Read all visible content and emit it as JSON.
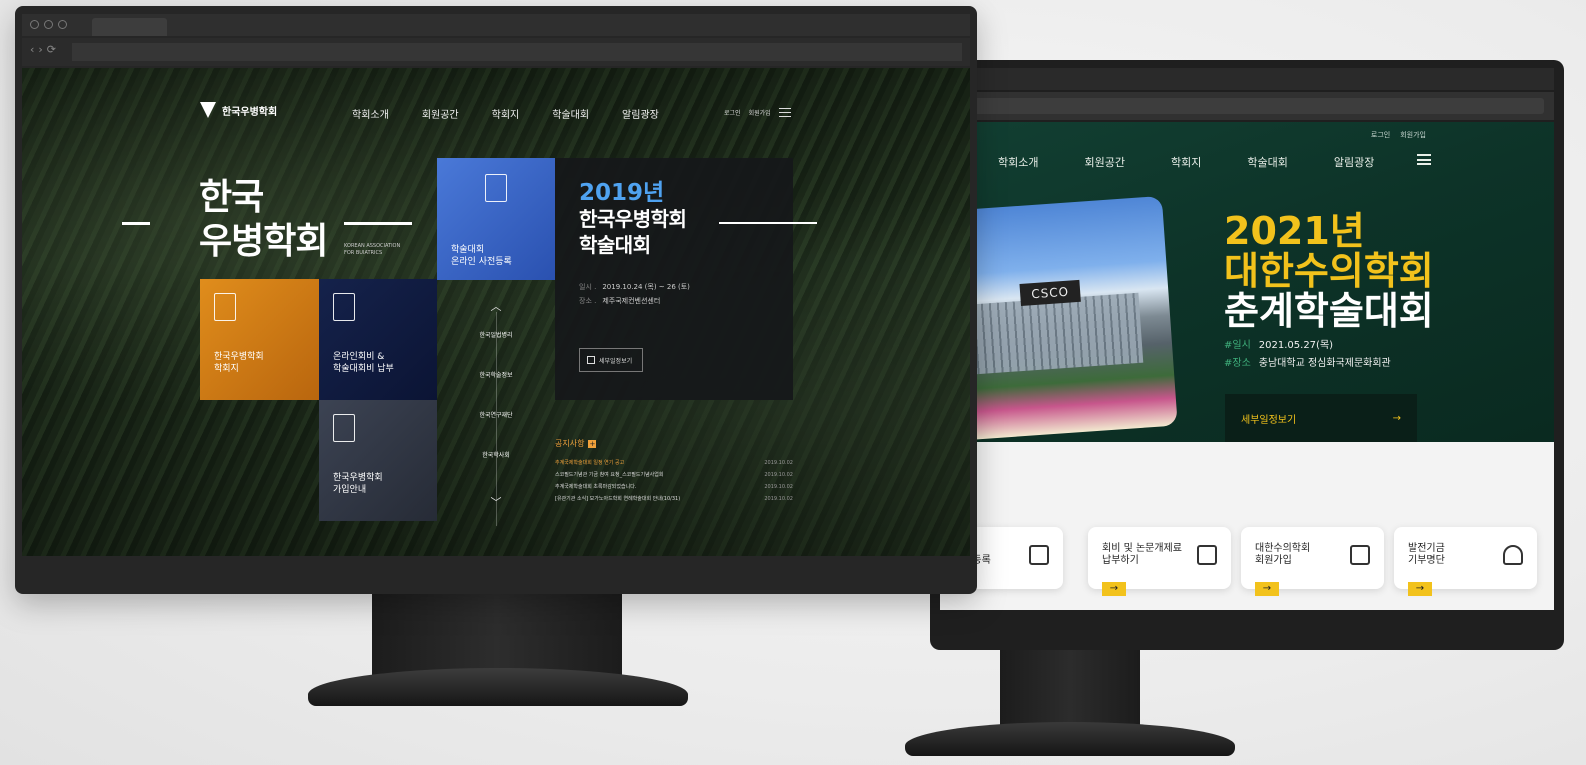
{
  "back_site": {
    "util": [
      "로그인",
      "회원가입"
    ],
    "nav": [
      "학회소개",
      "회원공간",
      "학회지",
      "학술대회",
      "알림광장"
    ],
    "photo_sign": "CSCO",
    "title_year": "2021년",
    "title_line1": "대한수의학회",
    "title_line2": "춘계학술대회",
    "info": [
      {
        "key": "#일시",
        "value": "2021.05.27(목)"
      },
      {
        "key": "#장소",
        "value": "충남대학교 정심화국제문화회관"
      }
    ],
    "detail_button": "세부일정보기",
    "detail_arrow": "→",
    "cards": [
      {
        "l1": "회",
        "l2": "사전등록",
        "icon": "form-icon"
      },
      {
        "l1": "회비 및 논문개제료",
        "l2": "납부하기",
        "icon": "wallet-icon"
      },
      {
        "l1": "대한수의학회",
        "l2": "회원가입",
        "icon": "edit-icon"
      },
      {
        "l1": "발전기금",
        "l2": "기부명단",
        "icon": "sprout-icon"
      }
    ],
    "card_arrow": "→",
    "colors": {
      "hero": "#0d3328",
      "accent": "#f2c21c",
      "key": "#3fb07c"
    }
  },
  "front_site": {
    "logo_text": "한국우병학회",
    "nav": [
      "학회소개",
      "회원공간",
      "학회지",
      "학술대회",
      "알림광장"
    ],
    "util": [
      "로그인",
      "회원가입"
    ],
    "big_title_l1": "한국",
    "big_title_l2": "우병학회",
    "eng_l1": "KOREAN ASSOCIATION",
    "eng_l2": "FOR BUIATRICS",
    "tiles": {
      "blue": {
        "l1": "학술대회",
        "l2": "온라인 사전등록"
      },
      "orange": {
        "l1": "한국우병학회",
        "l2": "학회지"
      },
      "navy": {
        "l1": "온라인회비 &",
        "l2": "학술대회비 납부"
      },
      "gray": {
        "l1": "한국우병학회",
        "l2": "가입안내"
      }
    },
    "event": {
      "year": "2019년",
      "title_l1": "한국우병학회",
      "title_l2": "학술대회",
      "date_key": "일시 .",
      "date_val": "2019.10.24 (목) ~ 26 (토)",
      "place_key": "장소 .",
      "place_val": "제주국제컨벤션센터",
      "button": "세부일정보기"
    },
    "side_links": [
      "한국일법병리",
      "한국학술정보",
      "한국연구재단",
      "한국학사회"
    ],
    "side_up": "︿",
    "side_down": "﹀",
    "notice": {
      "heading": "공지사항",
      "plus": "+",
      "items": [
        {
          "text": "추계국제학술대회 일정 연기 공고",
          "date": "2019.10.02"
        },
        {
          "text": "스코필드기념관 기금 참여 요청_스코필드기념사업회",
          "date": "2019.10.02"
        },
        {
          "text": "추계국제학술대회 초록마감되었습니다.",
          "date": "2019.10.02"
        },
        {
          "text": "[유관기관 소식] 모가노아드학회 연례학술대회 안내(10/31)",
          "date": "2019.10.02"
        }
      ]
    },
    "colors": {
      "blue": "#3a65c4",
      "orange": "#d47b16",
      "navy": "#101c40",
      "event_year": "#4fa2f0",
      "notice": "#f0a13b"
    }
  }
}
